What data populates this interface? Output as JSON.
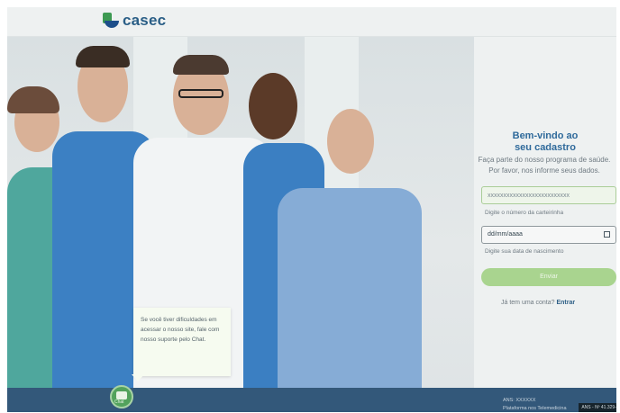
{
  "brand": {
    "name": "casec"
  },
  "signup": {
    "title_line1": "Bem-vindo ao",
    "title_line2": "seu cadastro",
    "subtitle_line1": "Faça parte do nosso programa de saúde.",
    "subtitle_line2": "Por favor, nos informe seus dados.",
    "card_input_value": "xxxxxxxxxxxxxxxxxxxxxxxxxx",
    "card_hint": "Digite o número da carteirinha",
    "birth_placeholder": "dd/mm/aaaa",
    "birth_hint": "Digite sua data de nascimento",
    "submit_label": "Enviar",
    "already_text": "Já tem uma conta?",
    "login_link": "Entrar"
  },
  "support": {
    "tooltip": "Se você tiver dificuldades em acessar o nosso site, fale com nosso suporte pelo Chat.",
    "chat_label": "Chat"
  },
  "footer": {
    "ans_line1": "ANS: XXXXXX",
    "ans_line2": "Plataforma nos Telemedicina",
    "badge": "ANS - Nº 41.329-0"
  },
  "colors": {
    "brand_green": "#52a25c",
    "brand_blue": "#2f6a9b",
    "footer": "#33587a"
  }
}
